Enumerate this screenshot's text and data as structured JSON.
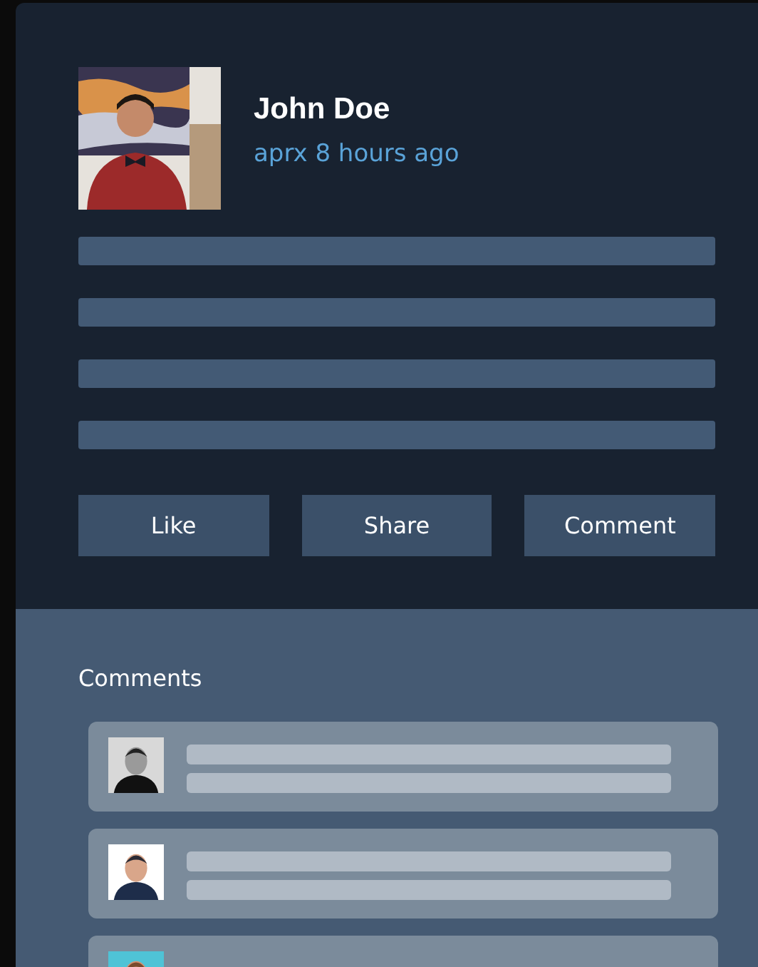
{
  "post": {
    "author": "John Doe",
    "time": "aprx 8 hours ago",
    "actions": [
      {
        "label": "Like"
      },
      {
        "label": "Share"
      },
      {
        "label": "Comment"
      }
    ]
  },
  "comments": {
    "title": "Comments"
  }
}
